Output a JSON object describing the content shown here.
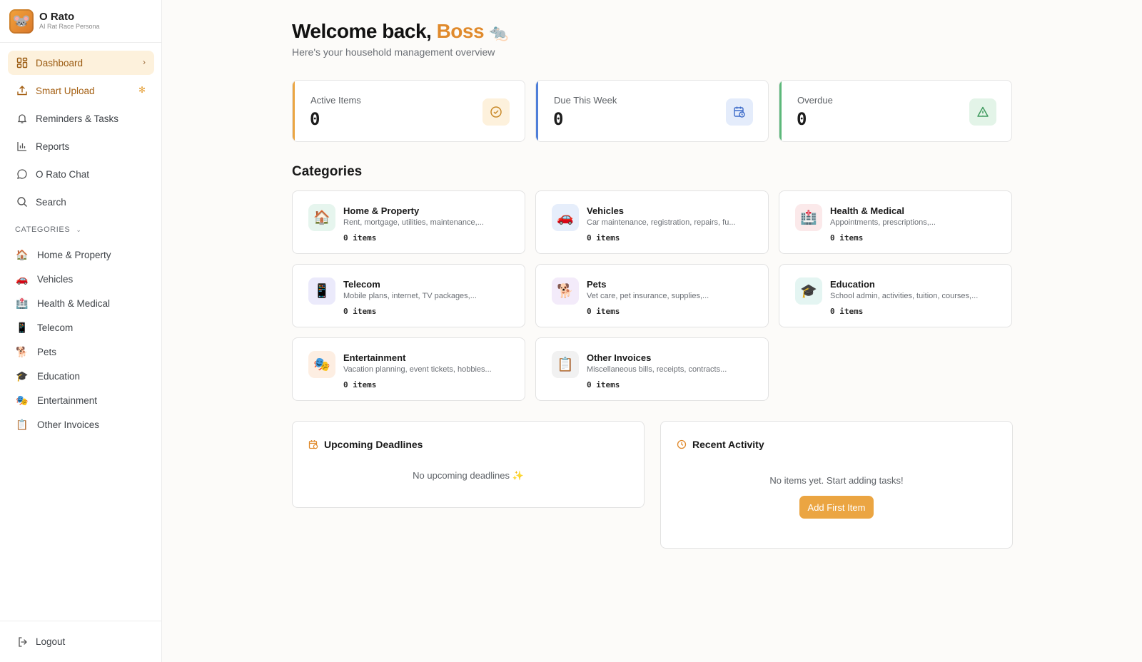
{
  "brand": {
    "title": "O Rato",
    "subtitle": "AI Rat Race Persona",
    "logo_emoji": "🐭"
  },
  "nav": [
    {
      "label": "Dashboard",
      "icon": "dashboard-grid-icon",
      "active": true
    },
    {
      "label": "Smart Upload",
      "icon": "upload-icon"
    },
    {
      "label": "Reminders & Tasks",
      "icon": "bell-icon"
    },
    {
      "label": "Reports",
      "icon": "bar-chart-icon"
    },
    {
      "label": "O Rato Chat",
      "icon": "chat-bubble-icon"
    },
    {
      "label": "Search",
      "icon": "search-icon"
    }
  ],
  "sidebar_categories": {
    "header": "CATEGORIES",
    "items": [
      {
        "label": "Home & Property",
        "emoji": "🏠"
      },
      {
        "label": "Vehicles",
        "emoji": "🚗"
      },
      {
        "label": "Health & Medical",
        "emoji": "🏥"
      },
      {
        "label": "Telecom",
        "emoji": "📱"
      },
      {
        "label": "Pets",
        "emoji": "🐕"
      },
      {
        "label": "Education",
        "emoji": "🎓"
      },
      {
        "label": "Entertainment",
        "emoji": "🎭"
      },
      {
        "label": "Other Invoices",
        "emoji": "📋"
      }
    ]
  },
  "logout": "Logout",
  "header": {
    "welcome": "Welcome back,",
    "name": "Boss",
    "name_emoji": "🐀",
    "subtitle": "Here's your household management overview"
  },
  "stats": [
    {
      "label": "Active Items",
      "value": "0",
      "accent": "#eba542",
      "icon": "check-circle-icon",
      "icon_bg": "#fdf1dc",
      "icon_color": "#c98a2a"
    },
    {
      "label": "Due This Week",
      "value": "0",
      "accent": "#4f7fd9",
      "icon": "calendar-clock-icon",
      "icon_bg": "#e4ecfb",
      "icon_color": "#3d6bc9"
    },
    {
      "label": "Overdue",
      "value": "0",
      "accent": "#5cb87a",
      "icon": "warning-triangle-icon",
      "icon_bg": "#e3f4e8",
      "icon_color": "#3f9a5e"
    }
  ],
  "categories_title": "Categories",
  "categories": [
    {
      "name": "Home & Property",
      "desc": "Rent, mortgage, utilities, maintenance,...",
      "count": "0 items",
      "emoji": "🏠",
      "bg": "#e6f5ee"
    },
    {
      "name": "Vehicles",
      "desc": "Car maintenance, registration, repairs, fu...",
      "count": "0 items",
      "emoji": "🚗",
      "bg": "#e6eefb"
    },
    {
      "name": "Health & Medical",
      "desc": "Appointments, prescriptions,...",
      "count": "0 items",
      "emoji": "🏥",
      "bg": "#fbe9ea"
    },
    {
      "name": "Telecom",
      "desc": "Mobile plans, internet, TV packages,...",
      "count": "0 items",
      "emoji": "📱",
      "bg": "#ebeafb"
    },
    {
      "name": "Pets",
      "desc": "Vet care, pet insurance, supplies,...",
      "count": "0 items",
      "emoji": "🐕",
      "bg": "#f3ebfa"
    },
    {
      "name": "Education",
      "desc": "School admin, activities, tuition, courses,...",
      "count": "0 items",
      "emoji": "🎓",
      "bg": "#e4f5f2"
    },
    {
      "name": "Entertainment",
      "desc": "Vacation planning, event tickets, hobbies...",
      "count": "0 items",
      "emoji": "🎭",
      "bg": "#fdeee2"
    },
    {
      "name": "Other Invoices",
      "desc": "Miscellaneous bills, receipts, contracts...",
      "count": "0 items",
      "emoji": "📋",
      "bg": "#f1f1f1"
    }
  ],
  "upcoming": {
    "title": "Upcoming Deadlines",
    "empty": "No upcoming deadlines ✨"
  },
  "activity": {
    "title": "Recent Activity",
    "empty": "No items yet. Start adding tasks!",
    "button": "Add First Item"
  },
  "colors": {
    "accent": "#eba542",
    "brand": "#e08a2c"
  }
}
